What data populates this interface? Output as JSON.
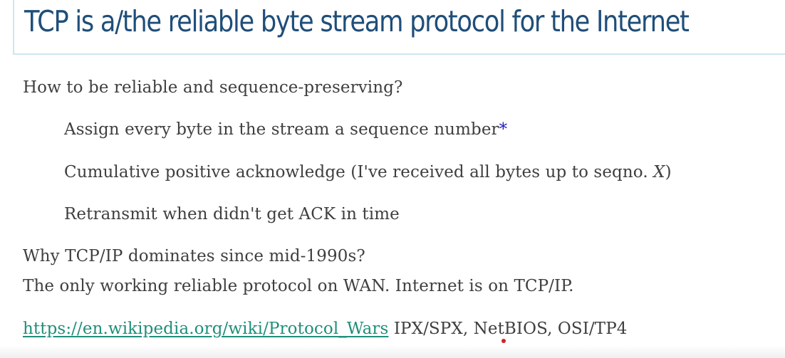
{
  "title": "TCP is a/the reliable byte stream protocol for the Internet",
  "body": {
    "question1": "How to be reliable and sequence-preserving?",
    "bullet1_text": "Assign every byte in the stream a sequence number",
    "bullet1_mark": "*",
    "bullet2_text": "Cumulative positive acknowledge (I've received all bytes up to seqno. ",
    "bullet2_var": "X",
    "bullet2_close": ")",
    "bullet3": "Retransmit when didn't get ACK in time",
    "question2": "Why TCP/IP dominates since mid-1990s?",
    "answer2": "The only working reliable protocol on WAN. Internet is on TCP/IP.",
    "link_text": "https://en.wikipedia.org/wiki/Protocol_Wars",
    "link_suffix": " IPX/SPX, NetBIOS, OSI/TP4"
  },
  "colors": {
    "title": "#1f4e79",
    "body_text": "#3f3f3f",
    "link": "#1f8f7a",
    "asterisk": "#1d1dbf",
    "cursor": "#d51f2b",
    "title_rule": "#cfe6ef"
  }
}
